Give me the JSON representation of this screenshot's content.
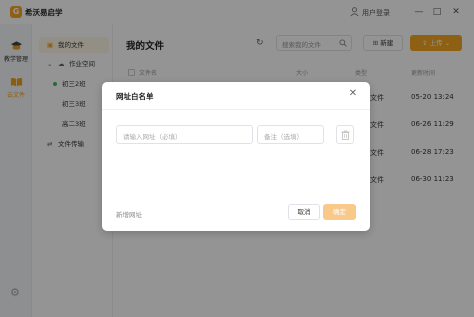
{
  "app": {
    "logo_char": "G",
    "name": "希沃易启学"
  },
  "titlebar": {
    "user_login": "用户登录",
    "minimize": "—",
    "maximize": "□",
    "close": "✕"
  },
  "rail": {
    "items": [
      {
        "label": "教学管理"
      },
      {
        "label": "云文件"
      }
    ]
  },
  "sidebar": {
    "items": [
      {
        "label": "我的文件"
      },
      {
        "label": "作业空间"
      },
      {
        "label": "初三2班"
      },
      {
        "label": "初三3班"
      },
      {
        "label": "高二3班"
      },
      {
        "label": "文件传输"
      }
    ]
  },
  "main": {
    "title": "我的文件",
    "search_placeholder": "搜索我的文件",
    "new_label": "新建",
    "upload_label": "上传",
    "columns": {
      "name": "文件名",
      "size": "大小",
      "type": "类型",
      "time": "更新时间"
    },
    "rows": [
      {
        "type": "文件",
        "time": "05-20 13:24"
      },
      {
        "type": "文件",
        "time": "06-26 11:29"
      },
      {
        "type": "文件",
        "time": "06-28 17:23"
      },
      {
        "type": "文件",
        "time": "06-30 11:23"
      }
    ]
  },
  "dialog": {
    "title": "网址白名单",
    "url_placeholder": "请输入网址（必填）",
    "note_placeholder": "备注（选填）",
    "add_url": "新增网址",
    "cancel": "取消",
    "ok": "确定"
  }
}
